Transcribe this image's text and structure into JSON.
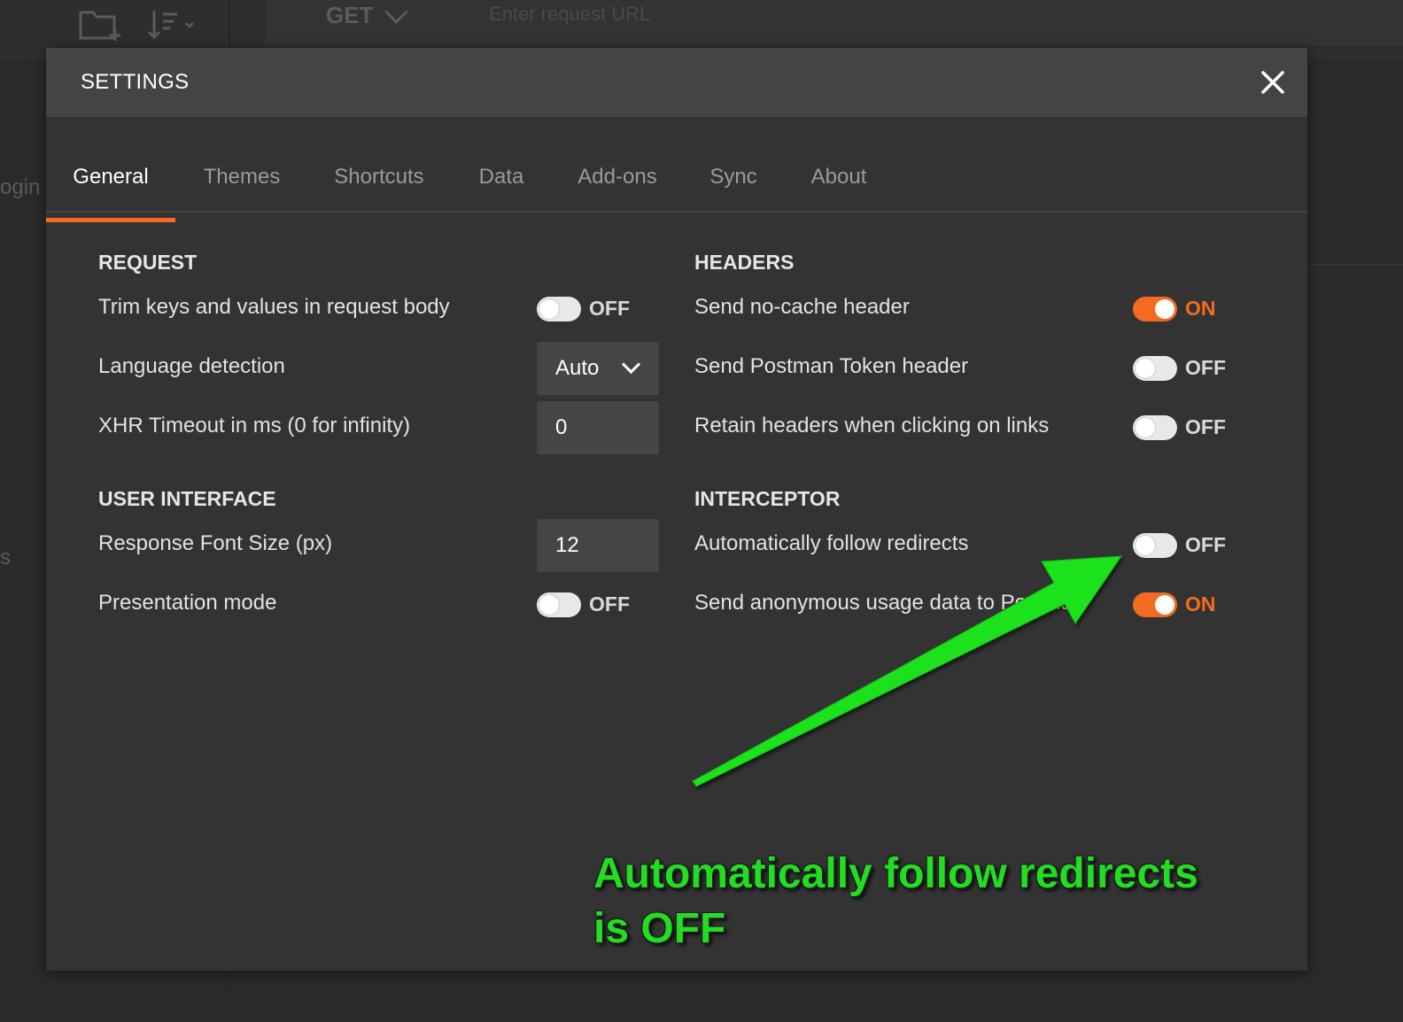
{
  "background": {
    "method": "GET",
    "url_placeholder": "Enter request URL",
    "sidebar_fragment_1": "ogin",
    "sidebar_fragment_2": "s",
    "icons": [
      "new-folder-icon",
      "sort-icon",
      "chevron-down-icon"
    ]
  },
  "modal": {
    "title": "SETTINGS",
    "close_icon": "close-icon",
    "tabs": [
      {
        "label": "General",
        "active": true
      },
      {
        "label": "Themes",
        "active": false
      },
      {
        "label": "Shortcuts",
        "active": false
      },
      {
        "label": "Data",
        "active": false
      },
      {
        "label": "Add-ons",
        "active": false
      },
      {
        "label": "Sync",
        "active": false
      },
      {
        "label": "About",
        "active": false
      }
    ],
    "request": {
      "title": "REQUEST",
      "trim": {
        "label": "Trim keys and values in request body",
        "state": "OFF"
      },
      "language": {
        "label": "Language detection",
        "value": "Auto"
      },
      "timeout": {
        "label": "XHR Timeout in ms (0 for infinity)",
        "value": "0"
      }
    },
    "ui": {
      "title": "USER INTERFACE",
      "font_size": {
        "label": "Response Font Size (px)",
        "value": "12"
      },
      "presentation": {
        "label": "Presentation mode",
        "state": "OFF"
      }
    },
    "headers": {
      "title": "HEADERS",
      "no_cache": {
        "label": "Send no-cache header",
        "state": "ON"
      },
      "postman_token": {
        "label": "Send Postman Token header",
        "state": "OFF"
      },
      "retain": {
        "label": "Retain headers when clicking on links",
        "state": "OFF"
      }
    },
    "interceptor": {
      "title": "INTERCEPTOR",
      "redirects": {
        "label": "Automatically follow redirects",
        "state": "OFF"
      },
      "anonymous": {
        "label": "Send anonymous usage data to Postman",
        "state": "ON"
      }
    }
  },
  "annotation": {
    "line1": "Automatically follow redirects",
    "line2": "is OFF",
    "color": "#22dd22"
  },
  "colors": {
    "accent": "#f26b21",
    "modal_bg": "#333333",
    "header_bg": "#444444"
  }
}
